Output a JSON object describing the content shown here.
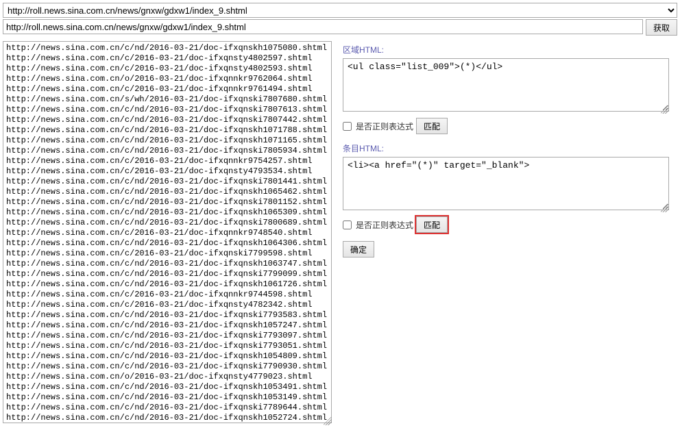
{
  "url_dropdown": {
    "selected": "http://roll.news.sina.com.cn/news/gnxw/gdxw1/index_9.shtml"
  },
  "url_input": "http://roll.news.sina.com.cn/news/gnxw/gdxw1/index_9.shtml",
  "fetch_button_label": "获取",
  "url_list_text": "http://news.sina.com.cn/c/nd/2016-03-21/doc-ifxqnskh1075080.shtml\nhttp://news.sina.com.cn/c/2016-03-21/doc-ifxqnsty4802597.shtml\nhttp://news.sina.com.cn/c/2016-03-21/doc-ifxqnsty4802593.shtml\nhttp://news.sina.com.cn/o/2016-03-21/doc-ifxqnnkr9762064.shtml\nhttp://news.sina.com.cn/c/2016-03-21/doc-ifxqnnkr9761494.shtml\nhttp://news.sina.com.cn/s/wh/2016-03-21/doc-ifxqnski7807680.shtml\nhttp://news.sina.com.cn/c/nd/2016-03-21/doc-ifxqnski7807613.shtml\nhttp://news.sina.com.cn/c/nd/2016-03-21/doc-ifxqnski7807442.shtml\nhttp://news.sina.com.cn/c/nd/2016-03-21/doc-ifxqnskh1071788.shtml\nhttp://news.sina.com.cn/c/nd/2016-03-21/doc-ifxqnskh1071165.shtml\nhttp://news.sina.com.cn/c/nd/2016-03-21/doc-ifxqnski7805934.shtml\nhttp://news.sina.com.cn/c/2016-03-21/doc-ifxqnnkr9754257.shtml\nhttp://news.sina.com.cn/c/2016-03-21/doc-ifxqnsty4793534.shtml\nhttp://news.sina.com.cn/c/nd/2016-03-21/doc-ifxqnski7801441.shtml\nhttp://news.sina.com.cn/c/nd/2016-03-21/doc-ifxqnskh1065462.shtml\nhttp://news.sina.com.cn/c/nd/2016-03-21/doc-ifxqnski7801152.shtml\nhttp://news.sina.com.cn/c/nd/2016-03-21/doc-ifxqnskh1065309.shtml\nhttp://news.sina.com.cn/c/nd/2016-03-21/doc-ifxqnski7800689.shtml\nhttp://news.sina.com.cn/c/2016-03-21/doc-ifxqnnkr9748540.shtml\nhttp://news.sina.com.cn/c/nd/2016-03-21/doc-ifxqnskh1064306.shtml\nhttp://news.sina.com.cn/c/2016-03-21/doc-ifxqnski7799598.shtml\nhttp://news.sina.com.cn/c/nd/2016-03-21/doc-ifxqnskh1063747.shtml\nhttp://news.sina.com.cn/c/nd/2016-03-21/doc-ifxqnski7799099.shtml\nhttp://news.sina.com.cn/c/nd/2016-03-21/doc-ifxqnskh1061726.shtml\nhttp://news.sina.com.cn/c/2016-03-21/doc-ifxqnnkr9744598.shtml\nhttp://news.sina.com.cn/c/2016-03-21/doc-ifxqnsty4782342.shtml\nhttp://news.sina.com.cn/c/nd/2016-03-21/doc-ifxqnski7793583.shtml\nhttp://news.sina.com.cn/c/nd/2016-03-21/doc-ifxqnskh1057247.shtml\nhttp://news.sina.com.cn/c/nd/2016-03-21/doc-ifxqnski7793097.shtml\nhttp://news.sina.com.cn/c/nd/2016-03-21/doc-ifxqnski7793051.shtml\nhttp://news.sina.com.cn/c/nd/2016-03-21/doc-ifxqnskh1054809.shtml\nhttp://news.sina.com.cn/c/nd/2016-03-21/doc-ifxqnski7790930.shtml\nhttp://news.sina.com.cn/o/2016-03-21/doc-ifxqnsty4779023.shtml\nhttp://news.sina.com.cn/c/nd/2016-03-21/doc-ifxqnskh1053491.shtml\nhttp://news.sina.com.cn/c/nd/2016-03-21/doc-ifxqnskh1053149.shtml\nhttp://news.sina.com.cn/c/nd/2016-03-21/doc-ifxqnski7789644.shtml\nhttp://news.sina.com.cn/c/nd/2016-03-21/doc-ifxqnskh1052724.shtml",
  "region": {
    "label": "区域HTML:",
    "value": "<ul class=\"list_009\">(*)</ul>",
    "regex_label": "是否正则表达式",
    "match_button": "匹配"
  },
  "entry": {
    "label": "条目HTML:",
    "value": "<li><a href=\"(*)\" target=\"_blank\">",
    "regex_label": "是否正则表达式",
    "match_button": "匹配"
  },
  "confirm_button_label": "确定"
}
